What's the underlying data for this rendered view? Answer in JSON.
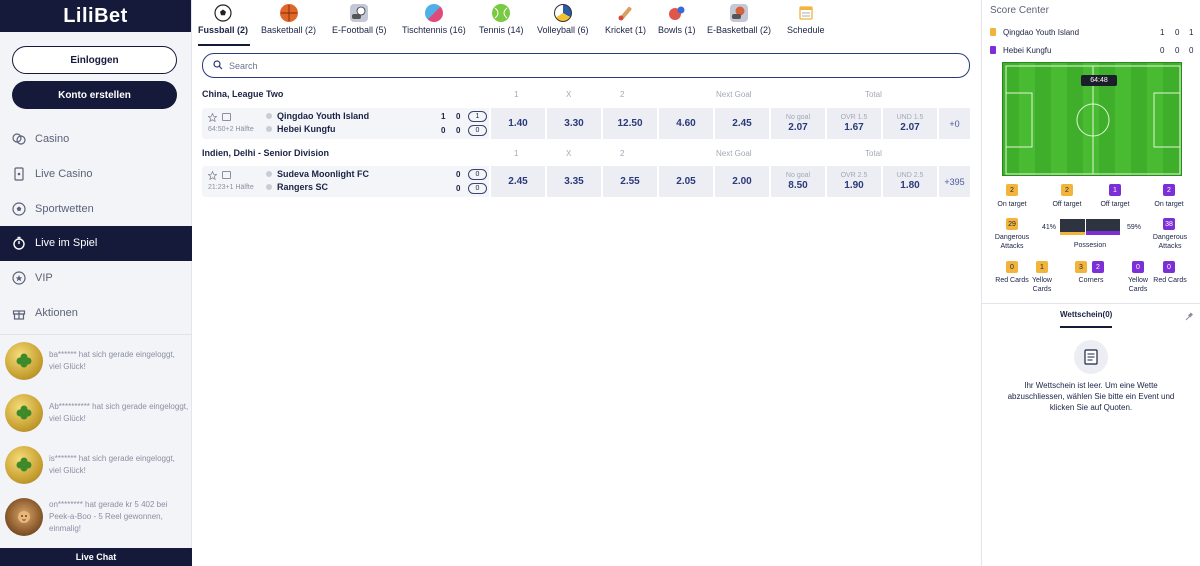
{
  "brand": {
    "logo": "LiliBet"
  },
  "auth": {
    "login": "Einloggen",
    "register": "Konto erstellen"
  },
  "nav": [
    {
      "label": "Casino",
      "icon": "chips-icon"
    },
    {
      "label": "Live Casino",
      "icon": "cards-icon"
    },
    {
      "label": "Sportwetten",
      "icon": "football-icon"
    },
    {
      "label": "Live im Spiel",
      "icon": "stopwatch-icon",
      "active": true
    },
    {
      "label": "VIP",
      "icon": "vip-icon"
    },
    {
      "label": "Aktionen",
      "icon": "gift-icon"
    }
  ],
  "feed": [
    {
      "text": "ba****** hat sich gerade eingeloggt, viel Glück!",
      "avatar": "clover-avatar"
    },
    {
      "text": "Ab********** hat sich gerade eingeloggt, viel Glück!",
      "avatar": "clover-avatar"
    },
    {
      "text": "is******* hat sich gerade eingeloggt, viel Glück!",
      "avatar": "clover-avatar"
    },
    {
      "text": "on******** hat gerade kr 5 402 bei Peek-a-Boo - 5 Reel gewonnen, einmalig!",
      "avatar": "lion-avatar"
    }
  ],
  "live_chat": "Live Chat",
  "tabs": [
    {
      "label": "Fussball (2)",
      "icon": "soccer-ball-icon",
      "color": "#222222",
      "active": true
    },
    {
      "label": "Basketball (2)",
      "icon": "basketball-icon",
      "color": "#e0662a"
    },
    {
      "label": "E-Football (5)",
      "icon": "e-football-icon",
      "color": "#6b7390"
    },
    {
      "label": "Tischtennis (16)",
      "icon": "table-tennis-icon",
      "color": "#e04a7a"
    },
    {
      "label": "Tennis (14)",
      "icon": "tennis-ball-icon",
      "color": "#7ac943"
    },
    {
      "label": "Volleyball (6)",
      "icon": "volleyball-icon",
      "color": "#2a5aa8"
    },
    {
      "label": "Kricket (1)",
      "icon": "cricket-icon",
      "color": "#d94a3a"
    },
    {
      "label": "Bowls (1)",
      "icon": "bowls-icon",
      "color": "#e0564a"
    },
    {
      "label": "E-Basketball (2)",
      "icon": "e-basketball-icon",
      "color": "#d9603a"
    },
    {
      "label": "Schedule",
      "icon": "schedule-icon",
      "color": "#f2b43a"
    }
  ],
  "search": {
    "placeholder": "Search"
  },
  "leagues": [
    {
      "name": "China, League Two",
      "headers": [
        "1",
        "X",
        "2",
        "Next Goal",
        "Total"
      ],
      "match": {
        "time": "64:50+2 Hälfte",
        "home": "Qingdao Youth Island",
        "away": "Hebei Kungfu",
        "home_scores": [
          "1",
          "0"
        ],
        "away_scores": [
          "0",
          "0"
        ],
        "home_pill": "1",
        "away_pill": "0",
        "odds": [
          {
            "label": "",
            "value": "1.40"
          },
          {
            "label": "",
            "value": "3.30"
          },
          {
            "label": "",
            "value": "12.50"
          },
          {
            "label": "",
            "value": "4.60"
          },
          {
            "label": "",
            "value": "2.45"
          },
          {
            "label": "No goal",
            "value": "2.07"
          },
          {
            "label": "OVR 1.5",
            "value": "1.67"
          },
          {
            "label": "UND 1.5",
            "value": "2.07"
          }
        ],
        "more": "+0"
      }
    },
    {
      "name": "Indien, Delhi - Senior Division",
      "headers": [
        "1",
        "X",
        "2",
        "Next Goal",
        "Total"
      ],
      "match": {
        "time": "21:23+1 Hälfte",
        "home": "Sudeva Moonlight FC",
        "away": "Rangers SC",
        "home_scores": [
          "0"
        ],
        "away_scores": [
          "0"
        ],
        "home_pill": "0",
        "away_pill": "0",
        "odds": [
          {
            "label": "",
            "value": "2.45"
          },
          {
            "label": "",
            "value": "3.35"
          },
          {
            "label": "",
            "value": "2.55"
          },
          {
            "label": "",
            "value": "2.05"
          },
          {
            "label": "",
            "value": "2.00"
          },
          {
            "label": "No goal",
            "value": "8.50"
          },
          {
            "label": "OVR 2.5",
            "value": "1.90"
          },
          {
            "label": "UND 2.5",
            "value": "1.80"
          }
        ],
        "more": "+395"
      }
    }
  ],
  "score_center": {
    "title": "Score Center",
    "home": {
      "name": "Qingdao Youth Island",
      "shirt_color": "#f2b43a",
      "scores": [
        "1",
        "0",
        "1"
      ]
    },
    "away": {
      "name": "Hebei Kungfu",
      "shirt_color": "#7c2fd6",
      "scores": [
        "0",
        "0",
        "0"
      ]
    },
    "clock": "64:48",
    "shots": [
      {
        "value": "2",
        "label": "On target",
        "team": "home"
      },
      {
        "value": "2",
        "label": "Off target",
        "team": "home"
      },
      {
        "value": "1",
        "label": "Off target",
        "team": "away"
      },
      {
        "value": "2",
        "label": "On target",
        "team": "away"
      }
    ],
    "attacks": {
      "home_value": "29",
      "home_label": "Dangerous Attacks",
      "away_value": "38",
      "away_label": "Dangerous Attacks",
      "home_pct": "41%",
      "away_pct": "59%",
      "possession_label": "Possesion",
      "home_possession": 0.41
    },
    "cards": [
      {
        "value": "0",
        "label": "Red Cards",
        "team": "home"
      },
      {
        "value": "1",
        "label": "Yellow Cards",
        "team": "home"
      },
      {
        "value": "3",
        "label": "",
        "team": "home"
      },
      {
        "value": "2",
        "label": "Corners",
        "team": "away"
      },
      {
        "value": "0",
        "label": "Yellow Cards",
        "team": "away"
      },
      {
        "value": "0",
        "label": "Red Cards",
        "team": "away"
      }
    ]
  },
  "betslip": {
    "tab": "Wettschein",
    "count": "(0)",
    "empty_text": "Ihr Wettschein ist leer. Um eine Wette abzuschliessen, wählen Sie bitte ein Event und klicken Sie auf Quoten."
  }
}
